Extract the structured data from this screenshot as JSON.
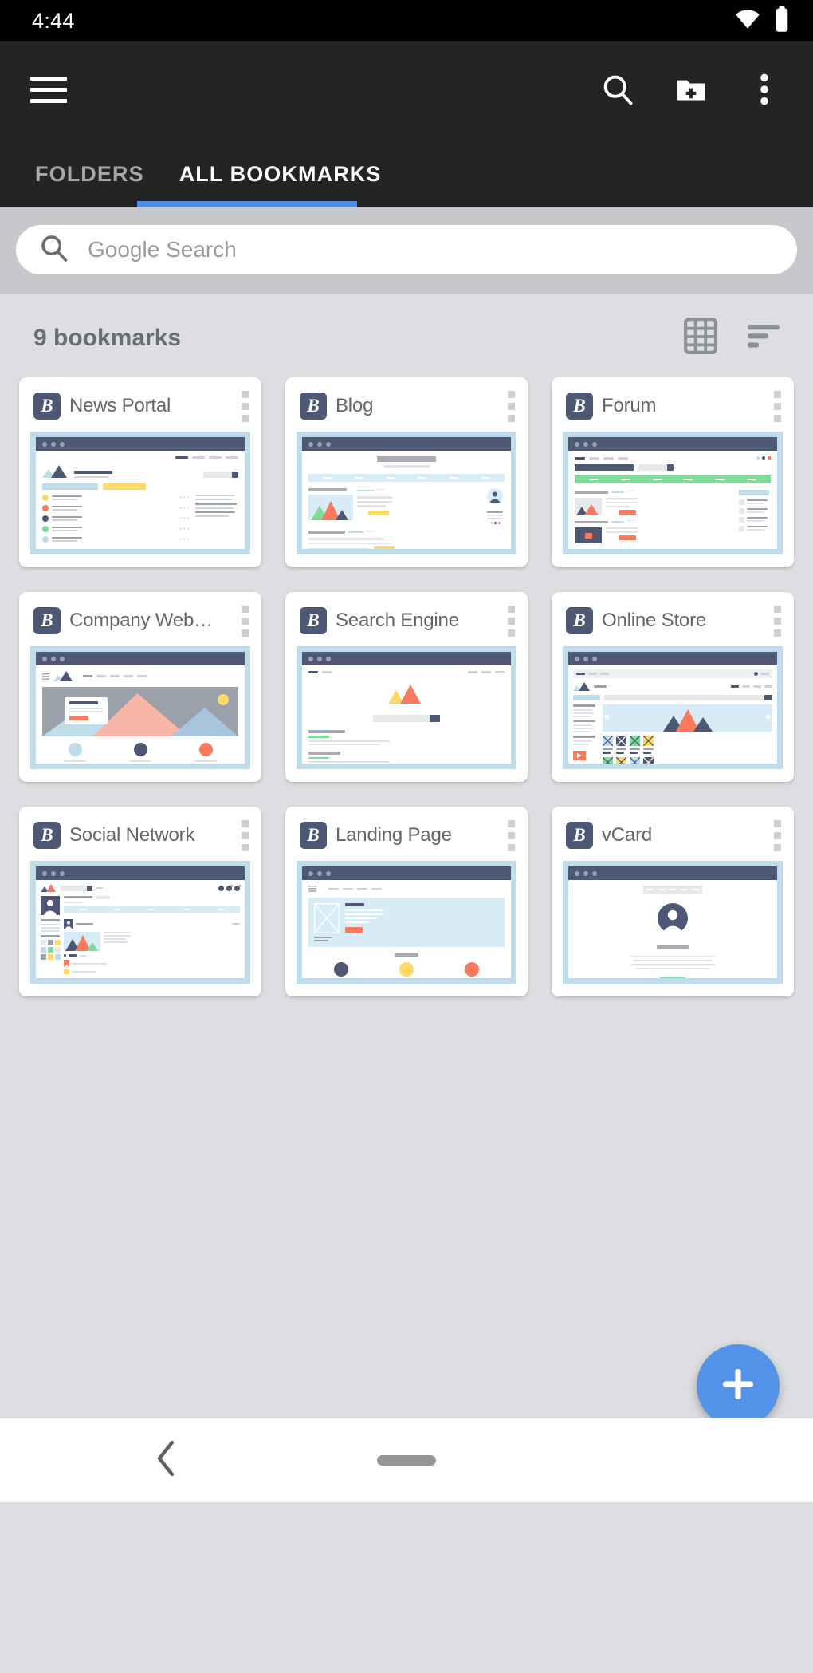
{
  "status": {
    "time": "4:44",
    "wifi_icon": "wifi-icon",
    "battery_icon": "battery-icon"
  },
  "appbar": {
    "menu_icon": "hamburger-menu-icon",
    "search_icon": "search-icon",
    "new_folder_icon": "new-folder-icon",
    "overflow_icon": "more-vert-icon",
    "tabs": [
      {
        "label": "FOLDERS",
        "active": false
      },
      {
        "label": "ALL BOOKMARKS",
        "active": true
      }
    ],
    "accent_color": "#4d8ce0"
  },
  "search": {
    "placeholder": "Google Search",
    "value": "",
    "icon": "search-icon"
  },
  "toolbar": {
    "count_label": "9 bookmarks",
    "grid_view_icon": "grid-view-icon",
    "sort_icon": "sort-icon"
  },
  "bookmarks": [
    {
      "title": "News Portal",
      "favicon_letter": "B",
      "thumb": "news"
    },
    {
      "title": "Blog",
      "favicon_letter": "B",
      "thumb": "blog"
    },
    {
      "title": "Forum",
      "favicon_letter": "B",
      "thumb": "forum"
    },
    {
      "title": "Company Web…",
      "favicon_letter": "B",
      "thumb": "company"
    },
    {
      "title": "Search Engine",
      "favicon_letter": "B",
      "thumb": "search"
    },
    {
      "title": "Online Store",
      "favicon_letter": "B",
      "thumb": "store"
    },
    {
      "title": "Social Network",
      "favicon_letter": "B",
      "thumb": "social"
    },
    {
      "title": "Landing Page",
      "favicon_letter": "B",
      "thumb": "landing"
    },
    {
      "title": "vCard",
      "favicon_letter": "B",
      "thumb": "vcard"
    }
  ],
  "fab": {
    "label": "+",
    "icon": "add-icon",
    "color": "#5394e8"
  },
  "navbar": {
    "back_icon": "back-chevron-icon",
    "home_pill_icon": "home-pill-icon"
  }
}
